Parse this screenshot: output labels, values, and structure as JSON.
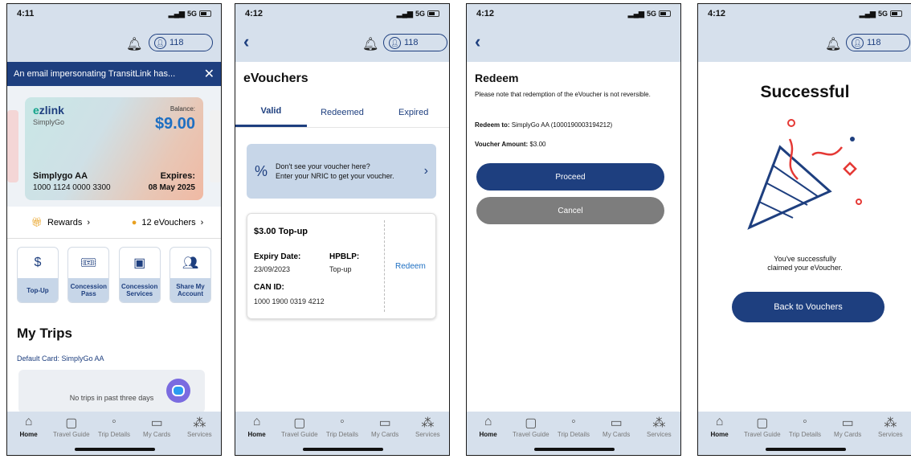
{
  "common": {
    "time1": "4:11",
    "time2": "4:12",
    "network": "5G",
    "points": "118",
    "nav": [
      "Home",
      "Travel Guide",
      "Trip Details",
      "My Cards",
      "Services"
    ]
  },
  "screen1": {
    "alert": "An email impersonating TransitLink has...",
    "card": {
      "brand_e": "e",
      "brand_rest": "zlink",
      "sub": "SimplyGo",
      "balance_label": "Balance:",
      "balance": "$9.00",
      "name": "Simplygo AA",
      "number": "1000 1124 0000 3300",
      "expires_label": "Expires:",
      "expires": "08 May 2025"
    },
    "rewards": "Rewards",
    "evouchers": "12 eVouchers",
    "tiles": [
      "Top-Up",
      "Concession Pass",
      "Concession Services",
      "Share My Account"
    ],
    "my_trips": "My Trips",
    "default_card": "Default Card:  SimplyGo AA",
    "no_trips": "No trips in past three days"
  },
  "screen2": {
    "title": "eVouchers",
    "tabs": [
      "Valid",
      "Redeemed",
      "Expired"
    ],
    "nric_line1": "Don't see your voucher here?",
    "nric_line2": "Enter your NRIC to get your voucher.",
    "voucher": {
      "title": "$3.00 Top-up",
      "expiry_label": "Expiry Date:",
      "expiry": "23/09/2023",
      "hpblp_label": "HPBLP:",
      "hpblp": "Top-up",
      "can_label": "CAN ID:",
      "can": "1000 1900 0319 4212",
      "redeem": "Redeem"
    }
  },
  "screen3": {
    "title": "Redeem",
    "note": "Please note that redemption of the eVoucher is not reversible.",
    "redeem_to_label": "Redeem to:",
    "redeem_to": "SimplyGo AA (1000190003194212)",
    "amount_label": "Voucher Amount:",
    "amount": "$3.00",
    "proceed": "Proceed",
    "cancel": "Cancel"
  },
  "screen4": {
    "title": "Successful",
    "message": "You've successfully claimed your eVoucher.",
    "back": "Back to Vouchers"
  },
  "colors": {
    "primary": "#1e3f7f",
    "header_bg": "#d6e0ec",
    "cancel_grey": "#7d7d7d"
  }
}
